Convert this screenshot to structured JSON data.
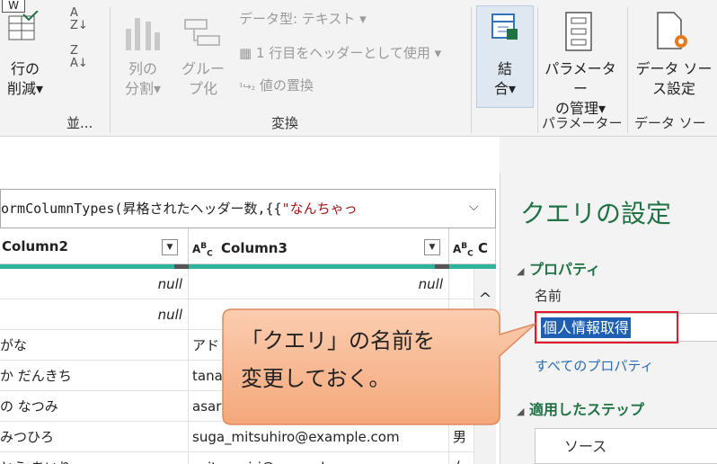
{
  "ribbon": {
    "w_tab": "W",
    "reduce_rows": {
      "line1": "行の",
      "line2": "削減▾"
    },
    "sort_label": "並...",
    "split_column": {
      "line1": "列の",
      "line2": "分割▾"
    },
    "group_by": {
      "line1": "グルー",
      "line2": "プ化"
    },
    "data_type": "データ型: テキスト ▾",
    "use_first_row": "1 行目をヘッダーとして使用 ▾",
    "replace_values": "値の置換",
    "transform_label": "変換",
    "combine": {
      "line1": "結",
      "line2": "合▾"
    },
    "manage_params": {
      "line1": "パラメーター",
      "line2": "の管理▾"
    },
    "params_label": "パラメーター",
    "data_source": {
      "line1": "データ ソー",
      "line2": "ス設定"
    },
    "data_source_label": "データ ソース"
  },
  "formula": {
    "prefix": "ormColumnTypes(昇格されたヘッダー数,{{",
    "string": "\"なんちゃっ"
  },
  "grid": {
    "headers": [
      "Column2",
      "Column3"
    ],
    "rows": [
      [
        "null",
        "null",
        ""
      ],
      [
        "null",
        "null",
        ""
      ],
      [
        "がな",
        "アド",
        ""
      ],
      [
        "か だんきち",
        "tana",
        ""
      ],
      [
        "の なつみ",
        "asar",
        ""
      ],
      [
        "みつひろ",
        "suga_mitsuhiro@example.com",
        "男"
      ],
      [
        "とう あいり",
        "saitou_airi@example.com",
        "女"
      ]
    ]
  },
  "settings": {
    "title": "クエリの設定",
    "properties": "プロパティ",
    "name_label": "名前",
    "name_value": "個人情報取得",
    "all_properties": "すべてのプロパティ",
    "applied_steps": "適用したステップ",
    "steps": [
      "ソース"
    ]
  },
  "callout": {
    "line1": "「クエリ」の名前を",
    "line2": "変更しておく。"
  },
  "colors": {
    "accent": "#217346",
    "quality_bar": "#2fb39a",
    "selection": "#1e5fb4",
    "highlight_box": "#e3162a",
    "callout_fill": "#f6b48f"
  }
}
